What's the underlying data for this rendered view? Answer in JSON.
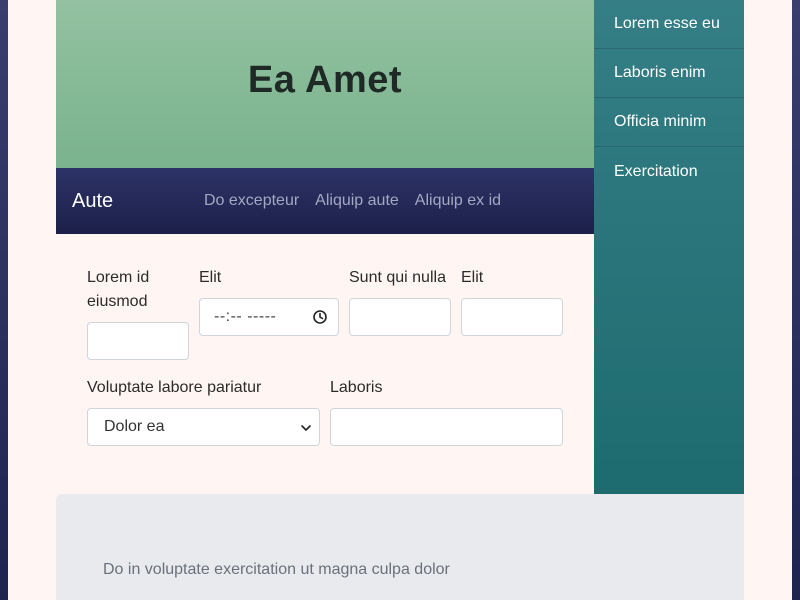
{
  "hero": {
    "title": "Ea Amet"
  },
  "navbar": {
    "brand": "Aute",
    "links": [
      "Do excepteur",
      "Aliquip aute",
      "Aliquip ex id"
    ]
  },
  "sidebar": {
    "items": [
      "Lorem esse eu",
      "Laboris enim",
      "Officia minim",
      "Exercitation"
    ]
  },
  "form": {
    "field1": {
      "label": "Lorem id eiusmod",
      "value": ""
    },
    "field2": {
      "label": "Elit",
      "placeholder": "--:-- -----"
    },
    "field3": {
      "label": "Sunt qui nulla",
      "value": ""
    },
    "field4": {
      "label": "Elit",
      "value": ""
    },
    "field5": {
      "label": "Voluptate labore pariatur",
      "selected": "Dolor ea"
    },
    "field6": {
      "label": "Laboris",
      "value": ""
    }
  },
  "footer": {
    "text": "Do in voluptate exercitation ut magna culpa dolor"
  },
  "colors": {
    "hero_bg": "#8fbf9f",
    "navbar_bg": "#262a5a",
    "sidebar_bg": "#2a7479",
    "page_bg": "#fff5f3",
    "footer_bg": "#e8eaed"
  }
}
